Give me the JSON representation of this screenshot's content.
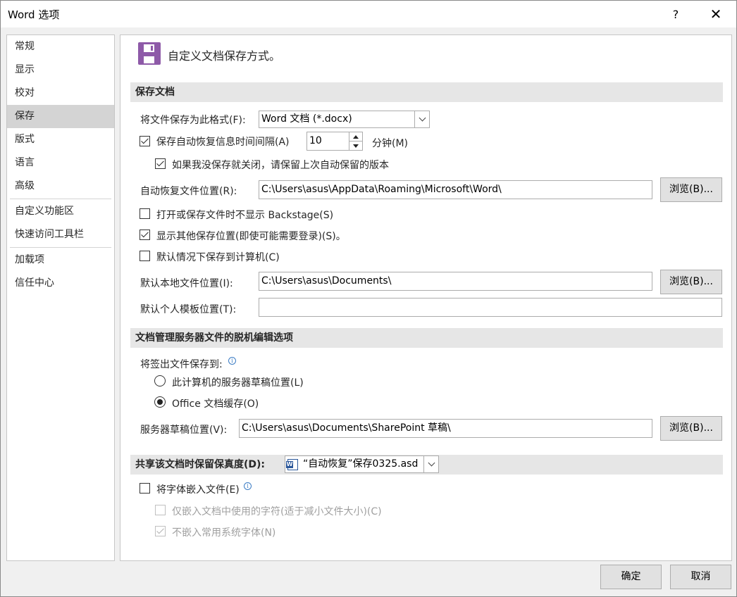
{
  "window": {
    "title": "Word 选项",
    "help_label": "?",
    "close_label": "✕"
  },
  "sidebar": {
    "items": [
      {
        "label": "常规"
      },
      {
        "label": "显示"
      },
      {
        "label": "校对"
      },
      {
        "label": "保存",
        "active": true
      },
      {
        "label": "版式"
      },
      {
        "label": "语言"
      },
      {
        "label": "高级"
      },
      {
        "label": "自定义功能区"
      },
      {
        "label": "快速访问工具栏"
      },
      {
        "label": "加载项"
      },
      {
        "label": "信任中心"
      }
    ]
  },
  "header": {
    "title": "自定义文档保存方式。",
    "icon": "floppy-disk-icon",
    "accent": "#8e5aa8"
  },
  "save_docs": {
    "section_title": "保存文档",
    "format_label": "将文件保存为此格式(F):",
    "format_value": "Word 文档 (*.docx)",
    "autorecover_label": "保存自动恢复信息时间间隔(A)",
    "autorecover_checked": true,
    "autorecover_minutes": "10",
    "minutes_label": "分钟(M)",
    "keep_last_label": "如果我没保存就关闭，请保留上次自动保留的版本",
    "keep_last_checked": true,
    "autorecover_location_label": "自动恢复文件位置(R):",
    "autorecover_location_value": "C:\\Users\\asus\\AppData\\Roaming\\Microsoft\\Word\\",
    "browse_label": "浏览(B)...",
    "no_backstage_label": "打开或保存文件时不显示 Backstage(S)",
    "no_backstage_checked": false,
    "show_other_locations_label": "显示其他保存位置(即使可能需要登录)(S)。",
    "show_other_locations_checked": true,
    "save_to_computer_label": "默认情况下保存到计算机(C)",
    "save_to_computer_checked": false,
    "local_location_label": "默认本地文件位置(I):",
    "local_location_value": "C:\\Users\\asus\\Documents\\",
    "template_location_label": "默认个人模板位置(T):",
    "template_location_value": ""
  },
  "offline": {
    "section_title": "文档管理服务器文件的脱机编辑选项",
    "save_checked_out_label": "将签出文件保存到:",
    "option_server_drafts": "此计算机的服务器草稿位置(L)",
    "option_office_cache": "Office 文档缓存(O)",
    "selected": "office_cache",
    "server_drafts_label": "服务器草稿位置(V):",
    "server_drafts_value": "C:\\Users\\asus\\Documents\\SharePoint 草稿\\"
  },
  "fidelity": {
    "section_title": "共享该文档时保留保真度(D):",
    "document_value": "“自动恢复”保存0325.asd",
    "embed_fonts_label": "将字体嵌入文件(E)",
    "embed_fonts_checked": false,
    "embed_used_chars_label": "仅嵌入文档中使用的字符(适于减小文件大小)(C)",
    "embed_used_chars_checked": false,
    "no_common_fonts_label": "不嵌入常用系统字体(N)",
    "no_common_fonts_checked": true
  },
  "footer": {
    "ok_label": "确定",
    "cancel_label": "取消"
  },
  "info_glyph": "i"
}
